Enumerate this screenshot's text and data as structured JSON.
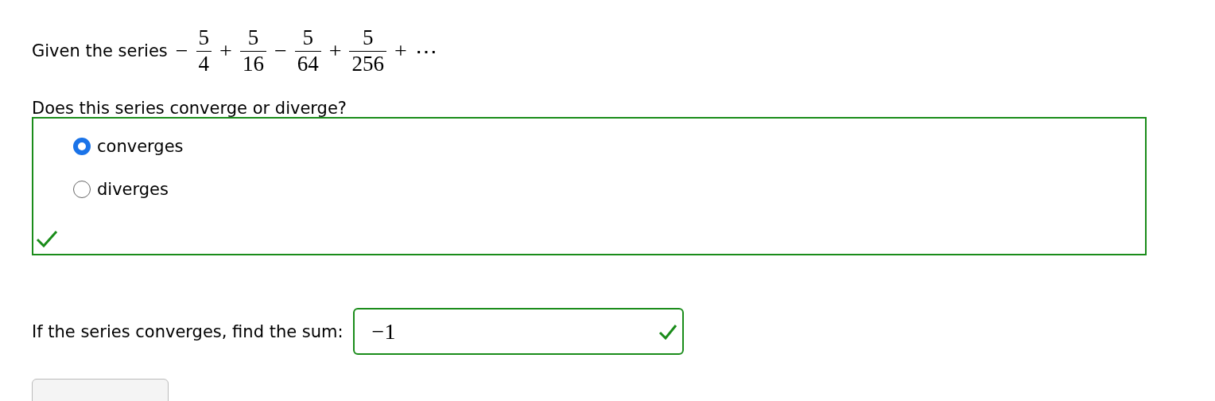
{
  "series": {
    "prefix": "Given the series",
    "terms": [
      {
        "sign": "−",
        "numerator": "5",
        "denominator": "4"
      },
      {
        "sign": "+",
        "numerator": "5",
        "denominator": "16"
      },
      {
        "sign": "−",
        "numerator": "5",
        "denominator": "64"
      },
      {
        "sign": "+",
        "numerator": "5",
        "denominator": "256"
      }
    ],
    "ending": {
      "sign": "+",
      "ellipsis": "⋯"
    }
  },
  "question": {
    "prompt": "Does this series converge or diverge?",
    "correct": true,
    "options": [
      {
        "label": "converges",
        "selected": true
      },
      {
        "label": "diverges",
        "selected": false
      }
    ]
  },
  "sum": {
    "label": "If the series converges, find the sum:",
    "value": "−1",
    "correct": true
  }
}
